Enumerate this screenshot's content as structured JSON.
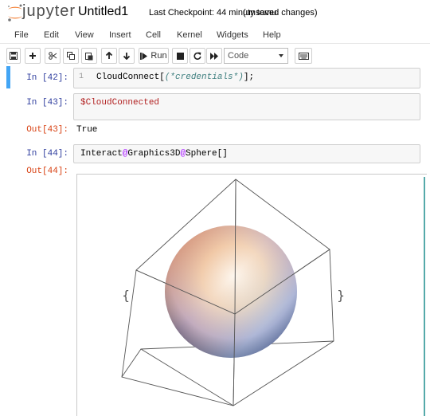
{
  "header": {
    "logo_text": "jupyter",
    "notebook_title": "Untitled1",
    "checkpoint": "Last Checkpoint: 44 minuty temu",
    "autosave_status": "(unsaved changes)"
  },
  "menubar": {
    "items": [
      "File",
      "Edit",
      "View",
      "Insert",
      "Cell",
      "Kernel",
      "Widgets",
      "Help"
    ]
  },
  "toolbar": {
    "run_label": "Run",
    "cell_type": "Code"
  },
  "cells": [
    {
      "in_prompt": "In [42]:",
      "line_number": "1",
      "code_parts": [
        "CloudConnect[",
        "(*credentials*)",
        "];"
      ]
    },
    {
      "in_prompt": "In [43]:",
      "code": "$CloudConnected",
      "out_prompt": "Out[43]:",
      "output": "True"
    },
    {
      "in_prompt": "In [44]:",
      "code_parts": [
        "Interact",
        "@",
        "Graphics3D",
        "@",
        "Sphere[]"
      ],
      "out_prompt": "Out[44]:",
      "output_left_brace": "{",
      "output_right_brace": "}"
    }
  ],
  "colors": {
    "in_prompt": "#303f9f",
    "out_prompt": "#d84315",
    "selected_cell_bar": "#42a5f5"
  }
}
